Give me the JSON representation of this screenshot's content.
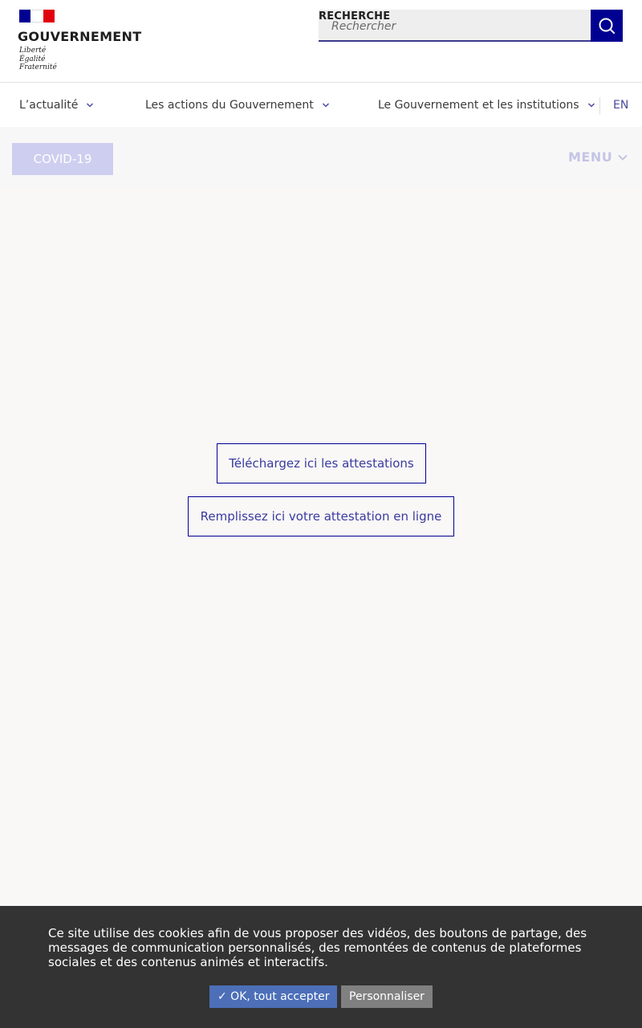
{
  "header": {
    "gov_name": "GOUVERNEMENT",
    "motto_line1": "Liberté",
    "motto_line2": "Égalité",
    "motto_line3": "Fraternité",
    "flag_colors": [
      "#000091",
      "#ffffff",
      "#e1000f"
    ],
    "search": {
      "label": "RECHERCHE",
      "placeholder": "Rechercher",
      "button_icon": "search-icon"
    }
  },
  "nav": {
    "items": [
      {
        "label": "L’actualité",
        "icon": "chevron-down-icon"
      },
      {
        "label": "Les actions du Gouvernement",
        "icon": "chevron-down-icon"
      },
      {
        "label": "Le Gouvernement et les institutions",
        "icon": "chevron-down-icon"
      }
    ],
    "lang": "EN"
  },
  "subbar": {
    "covid_label": "COVID-19",
    "menu_label": "MENU",
    "menu_icon": "chevron-down-icon"
  },
  "main": {
    "download_label": "Téléchargez ici les attestations",
    "online_label": "Remplissez ici votre attestation en ligne"
  },
  "cookie": {
    "text": "Ce site utilise des cookies afin de vous proposer des vidéos, des boutons de partage, des messages de communication personnalisés, des remontées de contenus de plateformes sociales et des contenus animés et interactifs.",
    "accept_label": "✓ OK, tout accepter",
    "customize_label": "Personnaliser"
  },
  "colors": {
    "brand_blue": "#000091",
    "cookie_bg": "#333333",
    "accept_bg": "#4c6fb8",
    "customize_bg": "#808080"
  }
}
